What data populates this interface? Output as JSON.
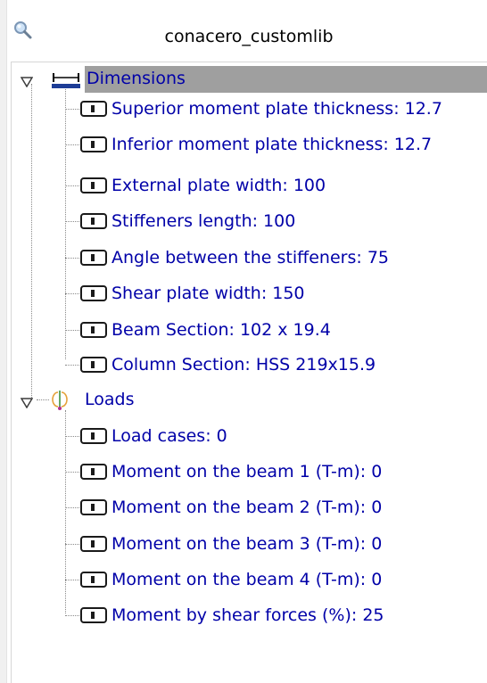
{
  "search": {
    "title": "conacero_customlib",
    "icon": "search-icon"
  },
  "tree": {
    "groups": [
      {
        "label": "Dimensions",
        "icon": "dimension-icon",
        "selected": true,
        "expanded": true,
        "items": [
          {
            "label": "Superior moment plate thickness: 12.7",
            "icon": "parameter-icon"
          },
          {
            "label": "Inferior moment plate thickness: 12.7",
            "icon": "parameter-icon"
          },
          {
            "label": "External plate width: 100",
            "icon": "parameter-icon"
          },
          {
            "label": "Stiffeners length: 100",
            "icon": "parameter-icon"
          },
          {
            "label": "Angle between the stiffeners: 75",
            "icon": "parameter-icon"
          },
          {
            "label": "Shear plate width: 150",
            "icon": "parameter-icon"
          },
          {
            "label": "Beam Section: 102 x 19.4",
            "icon": "parameter-icon"
          },
          {
            "label": "Column Section: HSS 219x15.9",
            "icon": "parameter-icon"
          }
        ]
      },
      {
        "label": "Loads",
        "icon": "load-icon",
        "selected": false,
        "expanded": true,
        "items": [
          {
            "label": "Load cases: 0",
            "icon": "parameter-icon"
          },
          {
            "label": "Moment on the beam 1 (T-m): 0",
            "icon": "parameter-icon"
          },
          {
            "label": "Moment on the beam 2 (T-m): 0",
            "icon": "parameter-icon"
          },
          {
            "label": "Moment on the beam 3 (T-m): 0",
            "icon": "parameter-icon"
          },
          {
            "label": "Moment on the beam 4 (T-m): 0",
            "icon": "parameter-icon"
          },
          {
            "label": "Moment by shear forces (%): 25",
            "icon": "parameter-icon"
          }
        ]
      }
    ]
  },
  "colors": {
    "label": "#0000a8",
    "selection": "#9f9f9f",
    "connector": "#8a8a8a"
  }
}
